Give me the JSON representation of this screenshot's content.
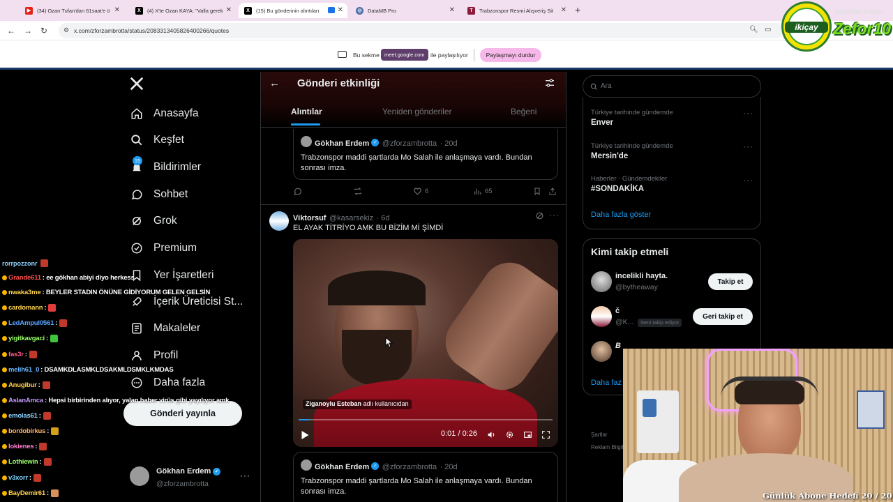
{
  "browser": {
    "tabs": [
      {
        "label": "(34) Ozan Tufan'dan 61saat'e ö",
        "color": "#e62117"
      },
      {
        "label": "(4) X'te Ozan KAYA: \"Valla gerek",
        "color": "#000000"
      },
      {
        "label": "(15) Bu gönderinin alıntıları",
        "color": "#000000"
      },
      {
        "label": "DataMB Pro",
        "color": "#4a6fa5"
      },
      {
        "label": "Trabzonspor Resmi Alışveriş Sit",
        "color": "#8b1a3a"
      }
    ],
    "url": "x.com/zforzambrotta/status/2083313405826400266/quotes"
  },
  "share_bar": {
    "text_before": "Bu sekme",
    "domain": "meet.google.com",
    "text_after": "ile paylaşılıyor",
    "stop_label": "Paylaşmayı durdur"
  },
  "overlay": {
    "logo_text": "ikiçay",
    "brand_text": "Zefor10",
    "brand_top": "İNDİRİM KODU",
    "goal_text": "Günlük Abone Hedefi 20 / 20"
  },
  "sidebar": {
    "items": [
      {
        "label": "Anasayfa"
      },
      {
        "label": "Keşfet"
      },
      {
        "label": "Bildirimler",
        "badge": "15"
      },
      {
        "label": "Sohbet"
      },
      {
        "label": "Grok"
      },
      {
        "label": "Premium"
      },
      {
        "label": "Yer İşaretleri"
      },
      {
        "label": "İçerik Üreticisi St..."
      },
      {
        "label": "Makaleler"
      },
      {
        "label": "Profil"
      },
      {
        "label": "Daha fazla"
      }
    ],
    "post_button": "Gönderi yayınla",
    "account": {
      "name": "Gökhan Erdem",
      "handle": "@zforzambrotta"
    }
  },
  "chat": [
    {
      "user": "Grande611",
      "msg": ": ee gökhan abiyi diyo herkess",
      "color": "#ff4d4d",
      "emote": ""
    },
    {
      "user": "nwaka3me",
      "msg": ": BEYLER STADIN ÖNÜNE GİDİYORUM GELEN GELSİN",
      "color": "#ffd24d",
      "emote": ""
    },
    {
      "user": "cardomann",
      "msg": ":",
      "color": "#ffd24d",
      "emote": "#e23b3b"
    },
    {
      "user": "LedAmpul0561",
      "msg": ":",
      "color": "#59a4ff",
      "emote": "#c0392b"
    },
    {
      "user": "yigitkavgaci",
      "msg": ":",
      "color": "#9cff6b",
      "emote": "#3ec53e"
    },
    {
      "user": "fas3r",
      "msg": ":",
      "color": "#ff5c8a",
      "emote": "#c0392b"
    },
    {
      "user": "melih61_0",
      "msg": ": DSAMKDLASMKLDSAKMLDSMKLKMDAS",
      "color": "#6ab4ff",
      "emote": ""
    },
    {
      "user": "Anugibur",
      "msg": ":",
      "color": "#ffd24d",
      "emote": "#c0392b"
    },
    {
      "user": "AslanAmca",
      "msg": ": Hepsi birbirinden alıyor, yalan haber virüs gibi yayılıyor amk",
      "color": "#c79bff",
      "emote": ""
    },
    {
      "user": "emolas61",
      "msg": ":",
      "color": "#8fd3ff",
      "emote": "#c0392b"
    },
    {
      "user": "bordobirkus",
      "msg": ":",
      "color": "#ffb36b",
      "emote": "#d4a017"
    },
    {
      "user": "lokienes",
      "msg": ":",
      "color": "#ff7fd1",
      "emote": "#c0392b"
    },
    {
      "user": "Lothiewin",
      "msg": ":",
      "color": "#9cff6b",
      "emote": "#c0392b"
    },
    {
      "user": "v3xorr",
      "msg": ":",
      "color": "#7dd3ff",
      "emote": "#c0392b"
    },
    {
      "user": "BayDemir61",
      "msg": ":",
      "color": "#ffd24d",
      "emote": "#d98f5a"
    }
  ],
  "main": {
    "title": "Gönderi etkinliği",
    "tabs": [
      "Alıntılar",
      "Yeniden gönderiler",
      "Beğeni"
    ],
    "quoted": {
      "name": "Gökhan Erdem",
      "handle": "@zforzambrotta",
      "time": "· 20d",
      "text": "Trabzonspor maddi şartlarda Mo Salah ile anlaşmaya vardı. Bundan sonrası imza."
    },
    "first_actions": {
      "likes": "6",
      "views": "65"
    },
    "post": {
      "name": "Viktorsuf",
      "handle": "@kasarsekiz",
      "time": "· 6d",
      "text": "EL AYAK TİTRİYO AMK BU BİZİM Mİ ŞİMDİ",
      "video_credit_user": "Ziganoylu Esteban",
      "video_credit_suffix": "adlı kullanıcıdan",
      "video_time": "0:01 / 0:26",
      "progress": 0.04
    }
  },
  "right": {
    "search_placeholder": "Ara",
    "trends": [
      {
        "category": "Türkiye tarihinde gündemde",
        "name": "Enver"
      },
      {
        "category": "Türkiye tarihinde gündemde",
        "name": "Mersin'de"
      },
      {
        "category": "Haberler · Gündemdekiler",
        "name": "#SONDAKİKA"
      }
    ],
    "show_more": "Daha fazla göster",
    "who_to_follow_title": "Kimi takip etmeli",
    "suggestions": [
      {
        "name": "incelikli hayta.",
        "handle": "@bytheaway",
        "button": "Takip et",
        "note": ""
      },
      {
        "name": "č",
        "handle": "@K...",
        "button": "Geri takip et",
        "note": "Seni takip ediyor"
      },
      {
        "name": "B",
        "handle": "",
        "button": "",
        "note": ""
      }
    ],
    "show_more_2": "Daha faz",
    "footer": [
      "Şartlar",
      "Reklam Bilgil"
    ]
  }
}
